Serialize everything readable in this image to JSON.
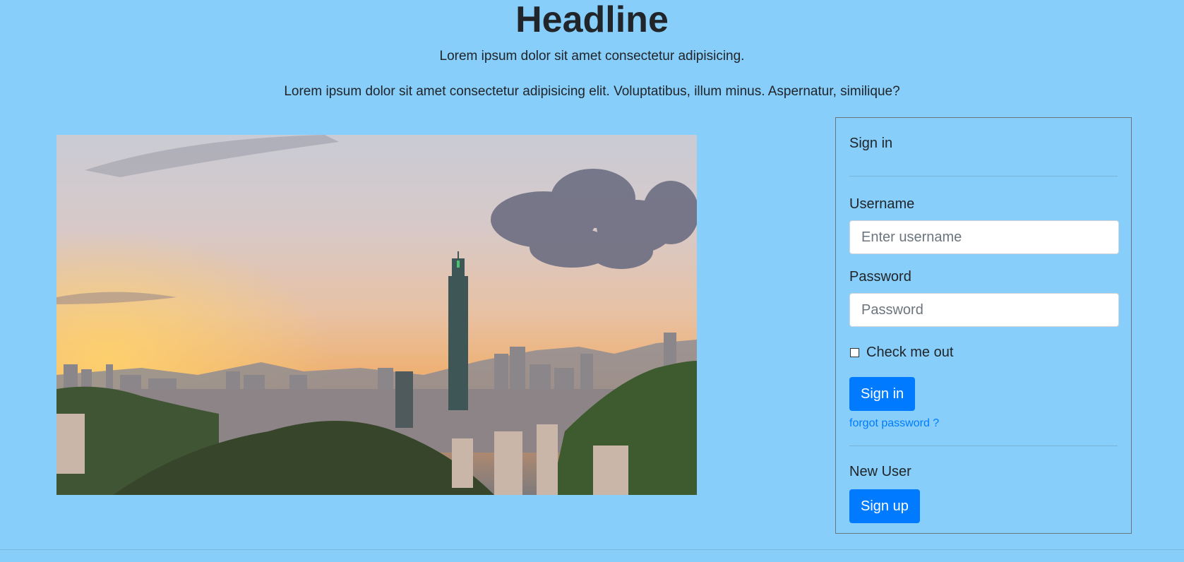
{
  "header": {
    "headline": "Headline",
    "subtitle": "Lorem ipsum dolor sit amet consectetur adipisicing.",
    "lead": "Lorem ipsum dolor sit amet consectetur adipisicing elit. Voluptatibus, illum minus. Aspernatur, similique?"
  },
  "signin": {
    "title": "Sign in",
    "username_label": "Username",
    "username_placeholder": "Enter username",
    "username_value": "",
    "password_label": "Password",
    "password_placeholder": "Password",
    "password_value": "",
    "remember_label": "Check me out",
    "remember_checked": false,
    "submit_label": "Sign in",
    "forgot_label": "forgot password ?",
    "new_user_label": "New User",
    "signup_label": "Sign up"
  },
  "colors": {
    "background": "#87cefa",
    "primary": "#007bff",
    "text": "#212529"
  },
  "icons": {
    "hero": "city-skyline-sunset-image"
  }
}
